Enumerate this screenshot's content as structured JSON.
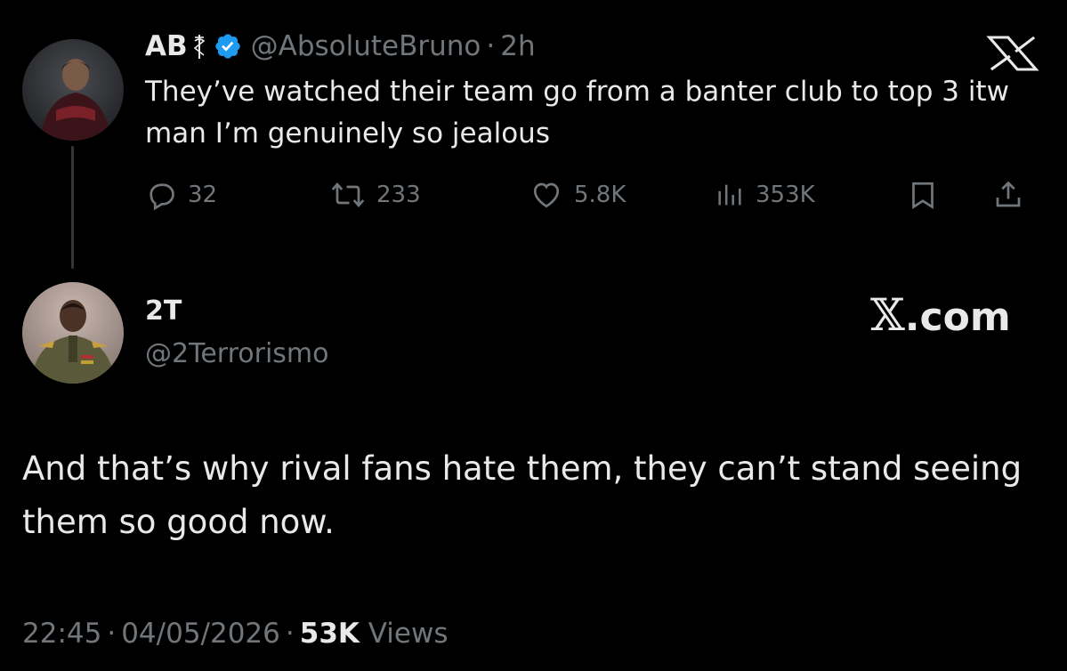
{
  "parent_tweet": {
    "name": "AB",
    "affiliation_icon": "caduceus-icon",
    "verified_icon": "verified-badge-icon",
    "handle": "@AbsoluteBruno",
    "separator": "·",
    "time": "2h",
    "text": "They’ve watched their team go from a banter club to top 3 itw man I’m genuinely so jealous",
    "actions": {
      "replies": "32",
      "reposts": "233",
      "likes": "5.8K",
      "views": "353K"
    }
  },
  "main_tweet": {
    "name": "2T",
    "handle": "@2Terrorismo",
    "text": "And that’s why rival fans hate them, they can’t stand seeing them so good now.",
    "time": "22:45",
    "separator": "·",
    "date": "04/05/2026",
    "views_count": "53K",
    "views_label": "Views"
  },
  "branding": {
    "x_logo_icon": "x-logo-icon",
    "x_logo_glyph": "𝕏",
    "watermark_suffix": ".com"
  },
  "colors": {
    "background": "#000000",
    "primary_text": "#e7e9ea",
    "secondary_text": "#71767b",
    "verified_blue": "#1d9bf0",
    "thread_line": "#333639"
  }
}
